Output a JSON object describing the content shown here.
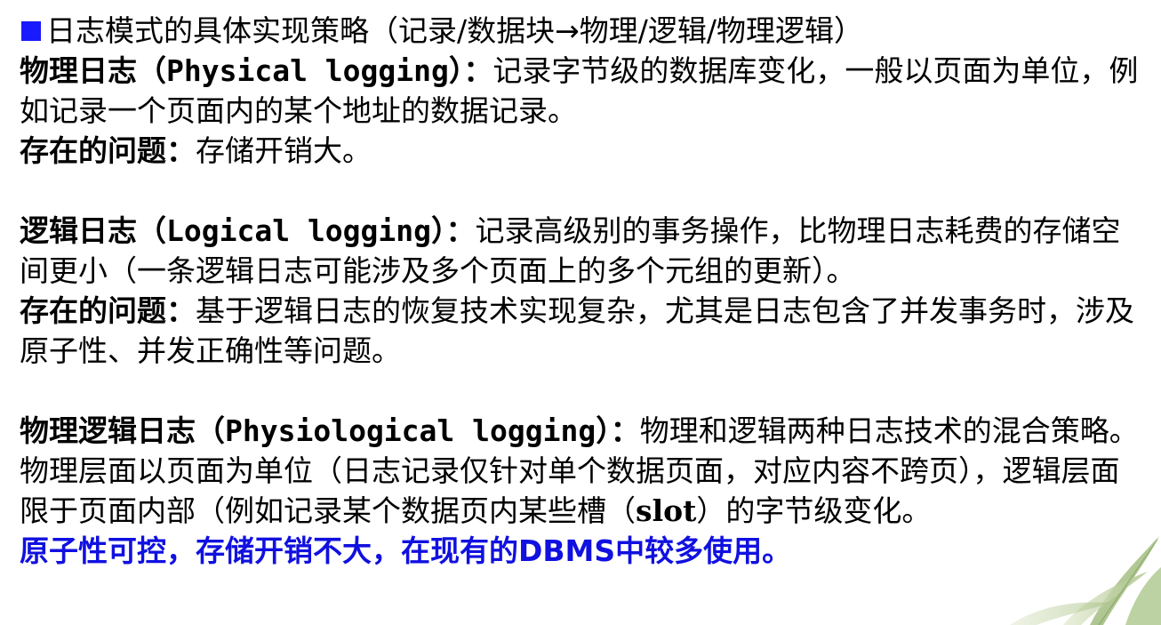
{
  "heading": {
    "text": "日志模式的具体实现策略（记录/数据块→物理/逻辑/物理逻辑）"
  },
  "physical": {
    "term": "物理日志（",
    "term_en": "Physical logging",
    "term_close": "）：",
    "desc": "记录字节级的数据库变化，一般以页面为单位，例如记录一个页面内的某个地址的数据记录。",
    "issue_label": "存在的问题：",
    "issue_text": "存储开销大。"
  },
  "logical": {
    "term": "逻辑日志（",
    "term_en": "Logical logging",
    "term_close": "）：",
    "desc": "记录高级别的事务操作，比物理日志耗费的存储空间更小（一条逻辑日志可能涉及多个页面上的多个元组的更新）。",
    "issue_label": "存在的问题：",
    "issue_text": "基于逻辑日志的恢复技术实现复杂，尤其是日志包含了并发事务时，涉及原子性、并发正确性等问题。"
  },
  "physiological": {
    "term": "物理逻辑日志（",
    "term_en": "Physiological logging",
    "term_close": "）：",
    "desc_a": "物理和逻辑两种日志技术的混合策略。物理层面以页面为单位（日志记录仅针对单个数据页面，对应内容不跨页），逻辑层面限于页面内部（例如记录某个数据页内某些槽（",
    "slot": "slot",
    "desc_b": "）的字节级变化。",
    "note": "原子性可控，存储开销不大，在现有的DBMS中较多使用。"
  },
  "colors": {
    "bullet": "#1a1aff",
    "note": "#1010e0",
    "text": "#000000"
  },
  "icons": {
    "bullet": "square-bullet-icon",
    "decoration": "bamboo-leaves-icon"
  }
}
